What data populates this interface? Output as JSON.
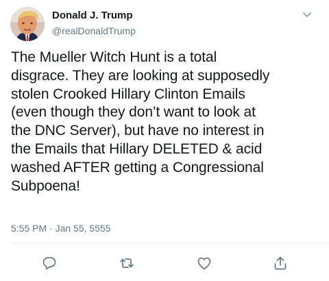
{
  "tweet": {
    "display_name": "Donald J. Trump",
    "handle": "@realDonaldTrump",
    "text": "The Mueller Witch Hunt is a total\ndisgrace. They are looking at supposedly\nstolen Crooked Hillary Clinton Emails\n(even though they don’t want to look at\nthe DNC Server), but have no interest in\nthe Emails that Hillary DELETED & acid\nwashed AFTER getting a Congressional\nSubpoena!",
    "timestamp": "5:55 PM · Jan 55, 5555"
  },
  "icons": {
    "caret": "chevron-down-icon",
    "reply": "reply-icon",
    "retweet": "retweet-icon",
    "like": "heart-icon",
    "share": "share-icon"
  },
  "colors": {
    "text": "#14171a",
    "secondary": "#657786",
    "icon": "#657786",
    "divider": "#e6ecf0"
  }
}
